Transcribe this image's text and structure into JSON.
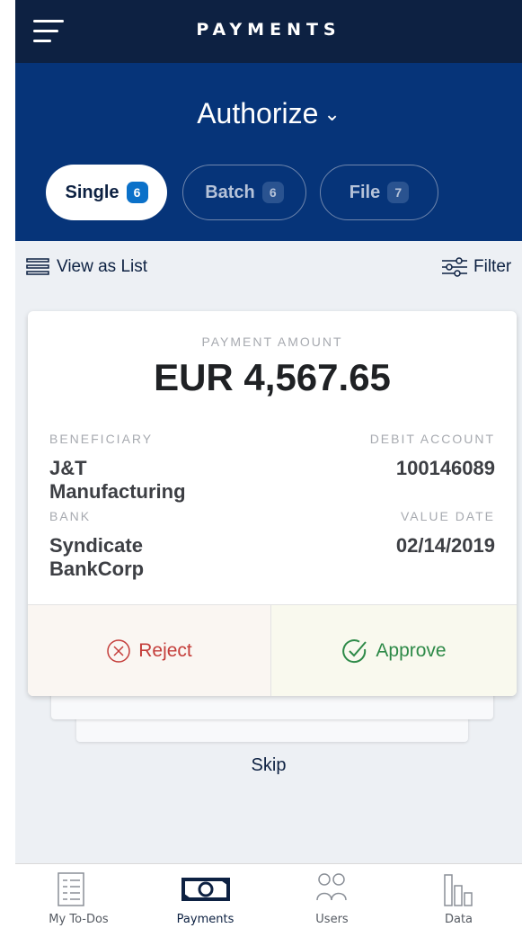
{
  "header": {
    "title": "PAYMENTS"
  },
  "hero": {
    "title": "Authorize",
    "tabs": [
      {
        "label": "Single",
        "count": "6",
        "active": true
      },
      {
        "label": "Batch",
        "count": "6",
        "active": false
      },
      {
        "label": "File",
        "count": "7",
        "active": false
      }
    ]
  },
  "toolbar": {
    "view_label": "View as List",
    "filter_label": "Filter"
  },
  "card": {
    "amount_label": "PAYMENT AMOUNT",
    "amount": "EUR 4,567.65",
    "beneficiary_label": "BENEFICIARY",
    "beneficiary_line1": "J&T",
    "beneficiary_line2": "Manufacturing",
    "debit_label": "DEBIT ACCOUNT",
    "debit_account": "100146089",
    "bank_label": "BANK",
    "bank_line1": "Syndicate",
    "bank_line2": "BankCorp",
    "value_date_label": "VALUE DATE",
    "value_date": "02/14/2019",
    "reject_label": "Reject",
    "approve_label": "Approve"
  },
  "skip_label": "Skip",
  "bottom_nav": [
    {
      "label": "My To-Dos",
      "icon": "checklist-icon"
    },
    {
      "label": "Payments",
      "icon": "money-icon",
      "active": true
    },
    {
      "label": "Users",
      "icon": "users-icon"
    },
    {
      "label": "Data",
      "icon": "bar-chart-icon"
    }
  ],
  "colors": {
    "header": "#0d2142",
    "hero": "#063479",
    "badge": "#0b71c9",
    "reject": "#c43d3a",
    "approve": "#2e8a48"
  }
}
